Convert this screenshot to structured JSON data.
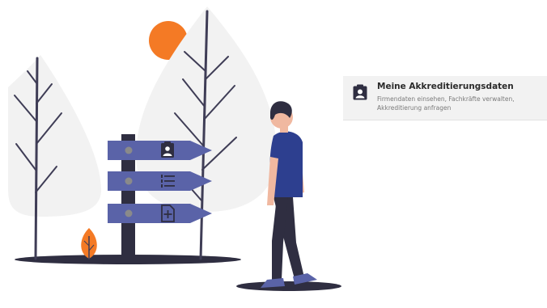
{
  "card": {
    "title": "Meine Akkreditierungsdaten",
    "description": "Firmendaten einsehen, Fachkräfte verwalten, Akkreditierung anfragen",
    "icon": "clipboard-user-icon"
  },
  "illustration": {
    "signpost_icons": [
      "clipboard-user-icon",
      "numbered-list-icon",
      "add-document-icon"
    ]
  },
  "colors": {
    "accent_orange": "#f47a25",
    "sign_blue": "#5a63a8",
    "dark_navy": "#2f2e41",
    "shirt_blue": "#2d3f8f",
    "tree_foliage": "#f2f2f2",
    "card_bg": "#f2f2f2"
  }
}
